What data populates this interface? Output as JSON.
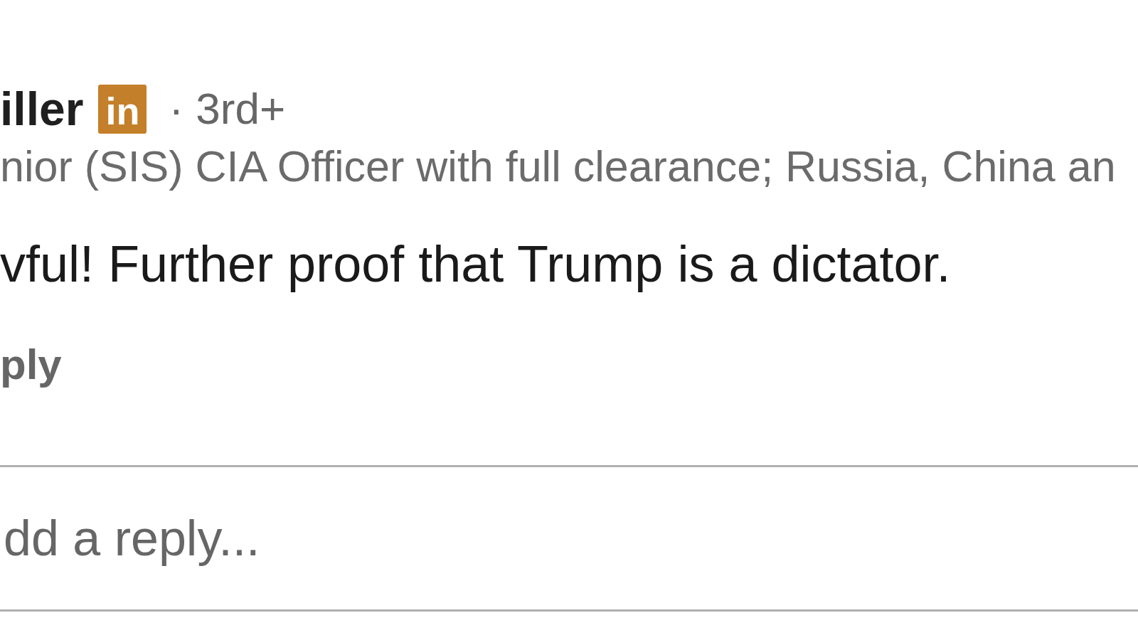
{
  "comment": {
    "author": {
      "name": "iller",
      "badge": "in",
      "connection": "· 3rd+",
      "headline": "nior (SIS) CIA Officer with full clearance; Russia, China an"
    },
    "text": "vful! Further proof that Trump is a dictator.",
    "actions": [
      "ply"
    ]
  },
  "reply_box": {
    "placeholder": "dd a reply..."
  }
}
